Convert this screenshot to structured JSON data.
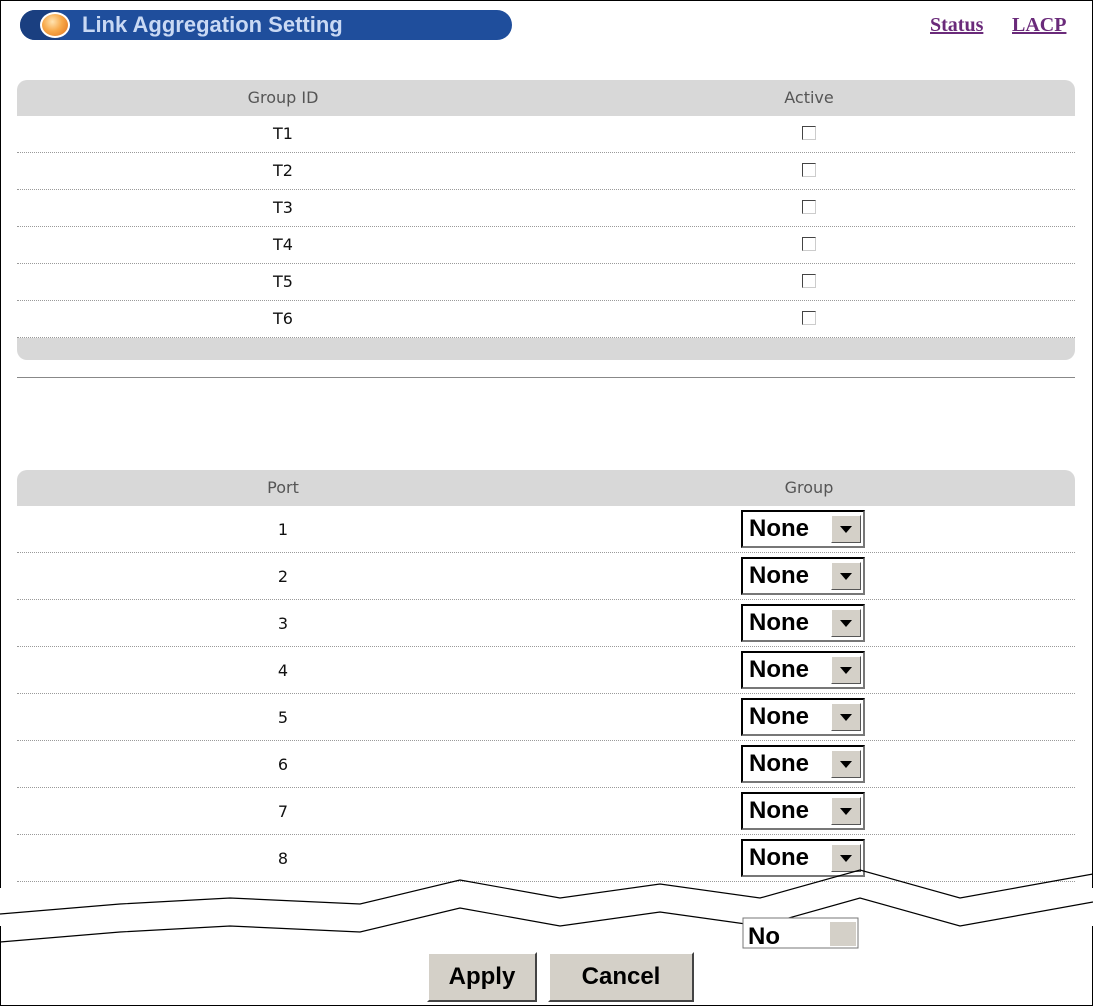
{
  "header": {
    "title": "Link Aggregation Setting",
    "links": [
      "Status",
      "LACP"
    ]
  },
  "group_table": {
    "columns": [
      "Group ID",
      "Active"
    ],
    "rows": [
      {
        "id": "T1",
        "active": false
      },
      {
        "id": "T2",
        "active": false
      },
      {
        "id": "T3",
        "active": false
      },
      {
        "id": "T4",
        "active": false
      },
      {
        "id": "T5",
        "active": false
      },
      {
        "id": "T6",
        "active": false
      }
    ]
  },
  "port_table": {
    "columns": [
      "Port",
      "Group"
    ],
    "rows": [
      {
        "port": "1",
        "group": "None"
      },
      {
        "port": "2",
        "group": "None"
      },
      {
        "port": "3",
        "group": "None"
      },
      {
        "port": "4",
        "group": "None"
      },
      {
        "port": "5",
        "group": "None"
      },
      {
        "port": "6",
        "group": "None"
      },
      {
        "port": "7",
        "group": "None"
      },
      {
        "port": "8",
        "group": "None"
      }
    ]
  },
  "buttons": {
    "apply": "Apply",
    "cancel": "Cancel"
  },
  "colors": {
    "title_bar": "#1f4e9c",
    "link": "#6a2a7a",
    "header_bg": "#d8d8d8"
  }
}
